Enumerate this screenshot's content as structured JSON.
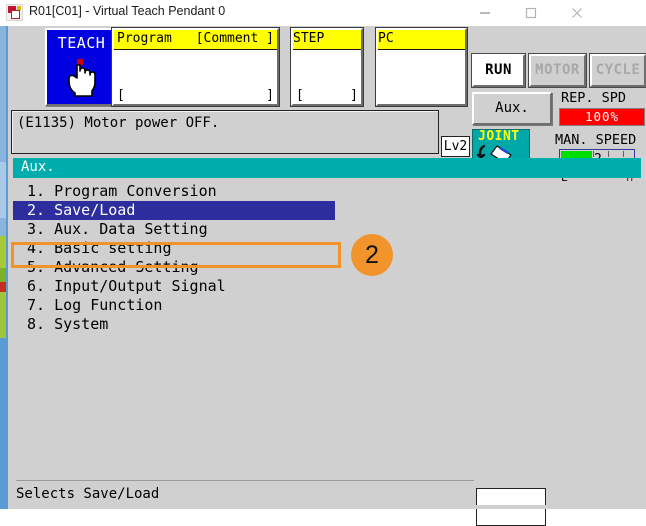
{
  "window": {
    "title": "R01[C01] - Virtual Teach Pendant 0",
    "app_icon": "robot-app-icon",
    "minimize_label": "minimize-icon",
    "maximize_label": "maximize-icon",
    "close_label": "close-icon"
  },
  "toolbar": {
    "teach": {
      "label": "TEACH",
      "icon": "pointing-hand-icon"
    },
    "program_panel": {
      "header_left": "Program",
      "header_right": "[Comment ]",
      "body_left": "[",
      "body_right": "]"
    },
    "step_panel": {
      "header": "STEP",
      "body_left": "[",
      "body_right": "]"
    },
    "pc_panel": {
      "header": "PC",
      "body_left": "",
      "body_right": ""
    },
    "mode_buttons": [
      {
        "label": "RUN",
        "active": true
      },
      {
        "label": "MOTOR",
        "active": false
      },
      {
        "label": "CYCLE",
        "active": false
      }
    ],
    "aux_button": "Aux.",
    "rep_speed": {
      "label": "REP. SPD",
      "value": "100%",
      "color": "#ff0000"
    },
    "man_speed": {
      "label": "MAN. SPEED",
      "value": "2",
      "low_label": "L",
      "high_label": "H",
      "fill_color": "#00e000"
    }
  },
  "message": {
    "text": "(E1135) Motor power OFF.",
    "level": "Lv2"
  },
  "joint": {
    "label": "JOINT",
    "icon": "robot-arm-icon",
    "color": "#00a8a8"
  },
  "screen": {
    "title": "Aux.",
    "title_bar_color": "#00adad",
    "menu": [
      {
        "num": "1.",
        "label": "Program Conversion",
        "text": "1.  Program Conversion"
      },
      {
        "num": "2.",
        "label": "Save/Load",
        "text": "2.  Save/Load"
      },
      {
        "num": "3.",
        "label": "Aux. Data Setting",
        "text": "3.  Aux. Data Setting"
      },
      {
        "num": "4.",
        "label": "Basic setting",
        "text": "4.  Basic setting"
      },
      {
        "num": "5.",
        "label": "Advanced Setting",
        "text": "5.  Advanced Setting"
      },
      {
        "num": "6.",
        "label": "Input/Output Signal",
        "text": "6.  Input/Output Signal"
      },
      {
        "num": "7.",
        "label": "Log Function",
        "text": "7.  Log Function"
      },
      {
        "num": "8.",
        "label": "System",
        "text": "8.  System"
      }
    ],
    "selected_index": 1,
    "selection_highlight_color": "#2d2d9e",
    "annotation": {
      "badge": "2",
      "badge_color": "#f0942b",
      "outline_color": "#f0932b"
    }
  },
  "status": {
    "text": "Selects Save/Load",
    "input_value": ""
  }
}
